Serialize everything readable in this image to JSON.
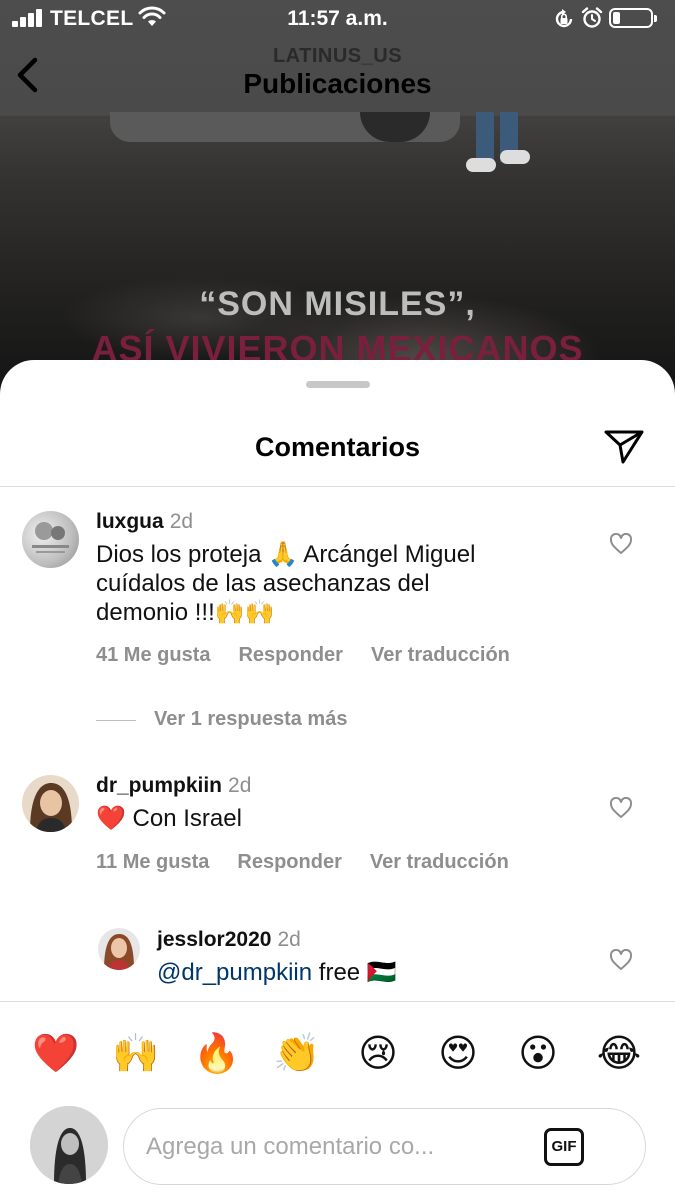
{
  "status_bar": {
    "carrier": "TELCEL",
    "time": "11:57 a.m.",
    "battery_level": 0.2
  },
  "header": {
    "account": "LATINUS_US",
    "title": "Publicaciones"
  },
  "post": {
    "headline_1": "“SON MISILES”,",
    "headline_2": "ASÍ VIVIERON MEXICANOS"
  },
  "sheet": {
    "title": "Comentarios"
  },
  "comments": [
    {
      "username": "luxgua",
      "time": "2d",
      "text_lines": [
        "Dios los proteja 🙏 Arcángel Miguel",
        "cuídalos de las asechanzas del",
        "demonio !!!🙌🙌"
      ],
      "likes": "41 Me gusta",
      "reply": "Responder",
      "translate": "Ver traducción"
    },
    {
      "username": "dr_pumpkiin",
      "time": "2d",
      "text": "❤️ Con Israel",
      "likes": "11 Me gusta",
      "reply": "Responder",
      "translate": "Ver traducción"
    },
    {
      "username": "jesslor2020",
      "time": "2d",
      "mention": "@dr_pumpkiin",
      "text": "free 🇵🇸"
    }
  ],
  "more_replies": "Ver 1 respuesta más",
  "emoji_bar": [
    "❤️",
    "🙌",
    "🔥",
    "👏",
    "😢",
    "😍",
    "😮",
    "😂"
  ],
  "input": {
    "placeholder": "Agrega un comentario co...",
    "gif_label": "GIF"
  }
}
